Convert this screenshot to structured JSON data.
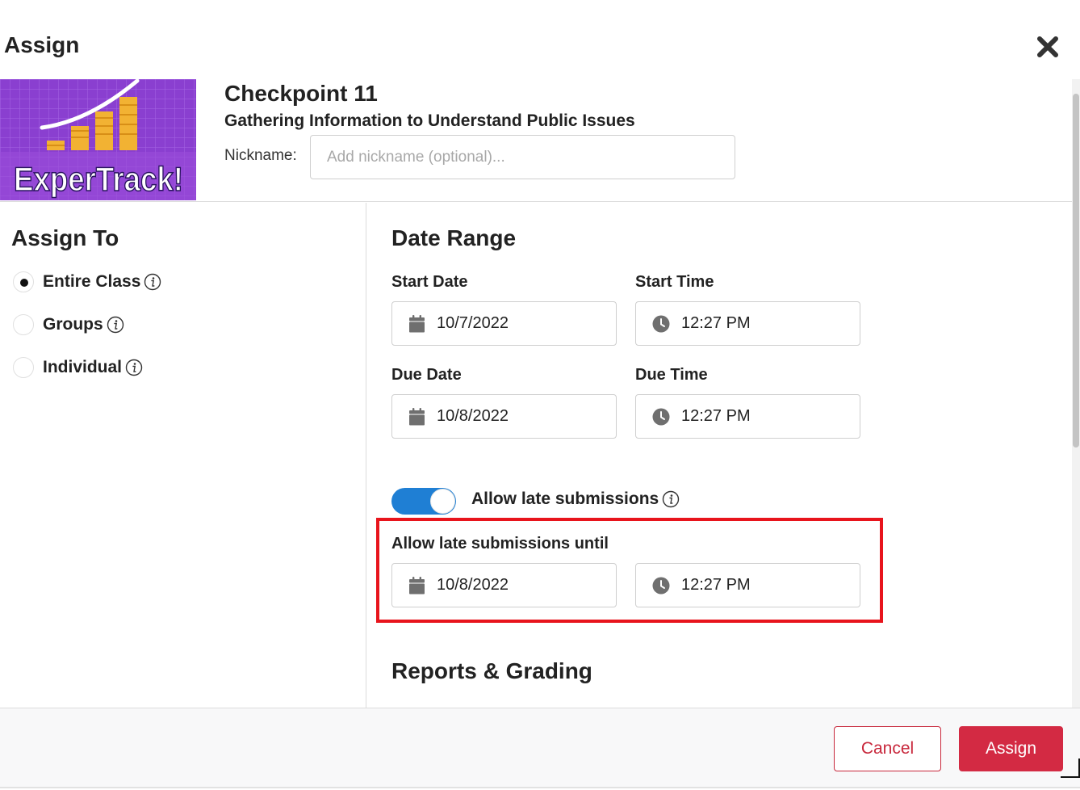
{
  "modal": {
    "title": "Assign",
    "close_icon": "close-icon"
  },
  "item": {
    "thumbnail_text": "ExperTrack!",
    "title": "Checkpoint 11",
    "subtitle": "Gathering Information to Understand Public Issues",
    "nickname_label": "Nickname:",
    "nickname_placeholder": "Add nickname (optional)...",
    "nickname_value": ""
  },
  "assign_to": {
    "heading": "Assign To",
    "options": [
      {
        "label": "Entire Class",
        "selected": true
      },
      {
        "label": "Groups",
        "selected": false
      },
      {
        "label": "Individual",
        "selected": false
      }
    ]
  },
  "date_range": {
    "heading": "Date Range",
    "start_date_label": "Start Date",
    "start_date": "10/7/2022",
    "start_time_label": "Start Time",
    "start_time": "12:27 PM",
    "due_date_label": "Due Date",
    "due_date": "10/8/2022",
    "due_time_label": "Due Time",
    "due_time": "12:27 PM"
  },
  "late": {
    "toggle_label": "Allow late submissions",
    "toggle_on": true,
    "until_label": "Allow late submissions until",
    "until_date": "10/8/2022",
    "until_time": "12:27 PM"
  },
  "reports": {
    "heading": "Reports & Grading"
  },
  "footer": {
    "cancel_label": "Cancel",
    "assign_label": "Assign"
  },
  "colors": {
    "toggle_on": "#1f7fd4",
    "primary_button": "#d32a43",
    "highlight": "#e8141c"
  }
}
